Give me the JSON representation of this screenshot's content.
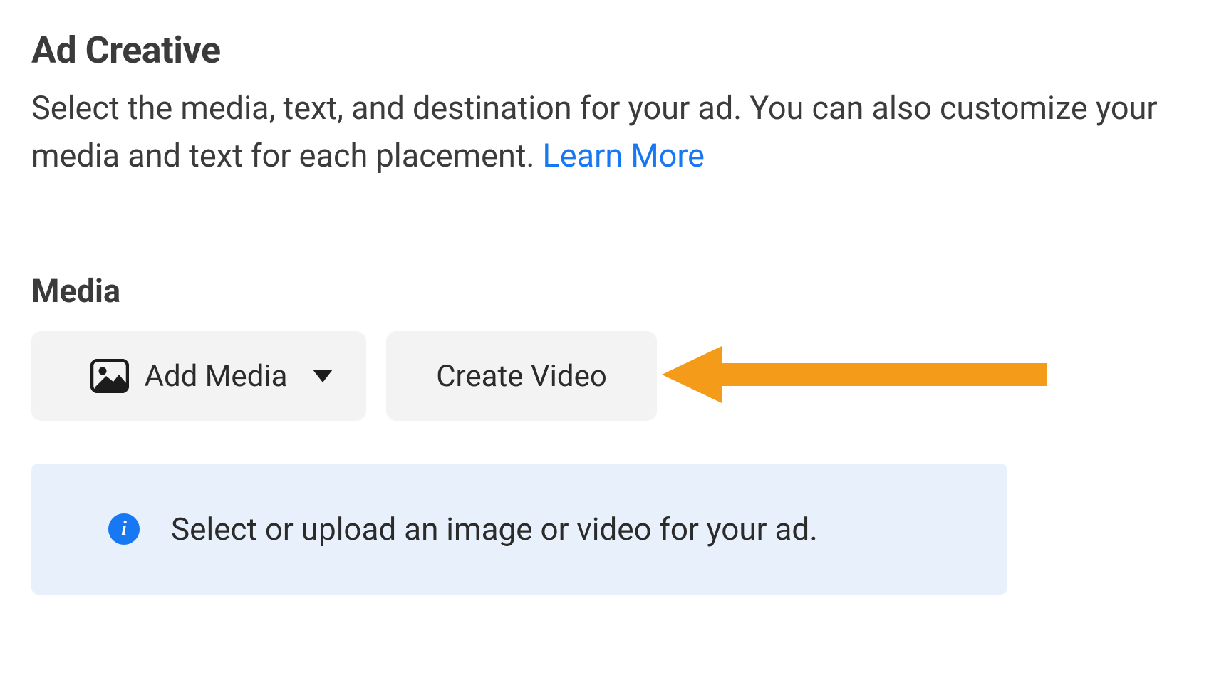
{
  "header": {
    "title": "Ad Creative",
    "description": "Select the media, text, and destination for your ad. You can also customize your media and text for each placement. ",
    "learn_more": "Learn More"
  },
  "media": {
    "label": "Media",
    "add_media_label": "Add Media",
    "create_video_label": "Create Video"
  },
  "info": {
    "text": "Select or upload an image or video for your ad."
  },
  "colors": {
    "accent": "#1877f2",
    "annotation": "#f39c12"
  }
}
